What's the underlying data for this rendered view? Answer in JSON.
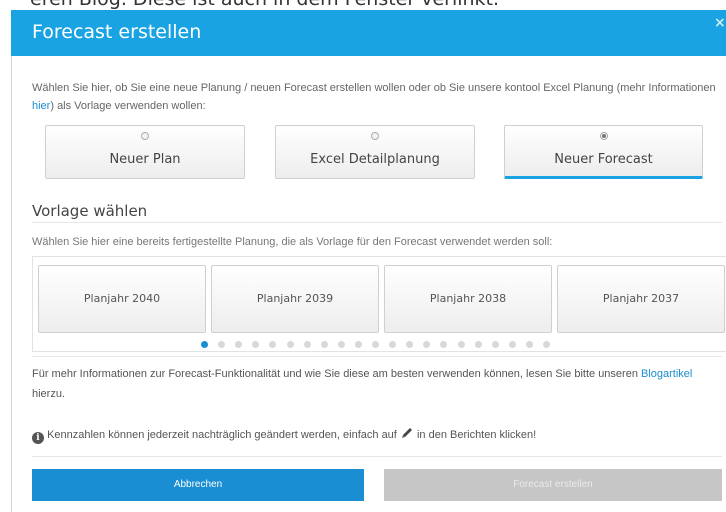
{
  "background": {
    "text": "eren Blog. Diese ist auch in dem Fenster verlinkt."
  },
  "modal": {
    "title": "Forecast erstellen"
  },
  "intro": {
    "part1": "Wählen Sie hier, ob Sie eine neue Planung / neuen Forecast erstellen wollen oder ob Sie unsere kontool Excel Planung (mehr Informationen ",
    "link": "hier",
    "part2": ") als Vorlage verwenden wollen:"
  },
  "choices": [
    {
      "label": "Neuer Plan",
      "selected": false
    },
    {
      "label": "Excel Detailplanung",
      "selected": false
    },
    {
      "label": "Neuer Forecast",
      "selected": true
    }
  ],
  "template_section": {
    "title": "Vorlage wählen",
    "description": "Wählen Sie hier eine bereits fertigestellte Planung, die als Vorlage für den Forecast verwendet werden soll:"
  },
  "templates": [
    "Planjahr 2040",
    "Planjahr 2039",
    "Planjahr 2038",
    "Planjahr 2037"
  ],
  "pagination": {
    "total": 21,
    "active": 1
  },
  "info": {
    "part1": "Für mehr Informationen zur Forecast-Funktionalität und wie Sie diese am besten verwenden können, lesen Sie bitte unseren ",
    "link": "Blogartikel",
    "part2": " hierzu."
  },
  "note": {
    "part1": "Kennzahlen können jederzeit nachträglich geändert werden, einfach auf ",
    "part2": " in den Berichten klicken!"
  },
  "buttons": {
    "cancel": "Abbrechen",
    "create": "Forecast erstellen"
  },
  "colors": {
    "accent": "#1aa3e2",
    "link": "#1a8ed2",
    "disabled": "#c6c6c6"
  },
  "icons": {
    "close": "close-icon",
    "info": "info-circle-icon",
    "edit": "pencil-icon"
  }
}
